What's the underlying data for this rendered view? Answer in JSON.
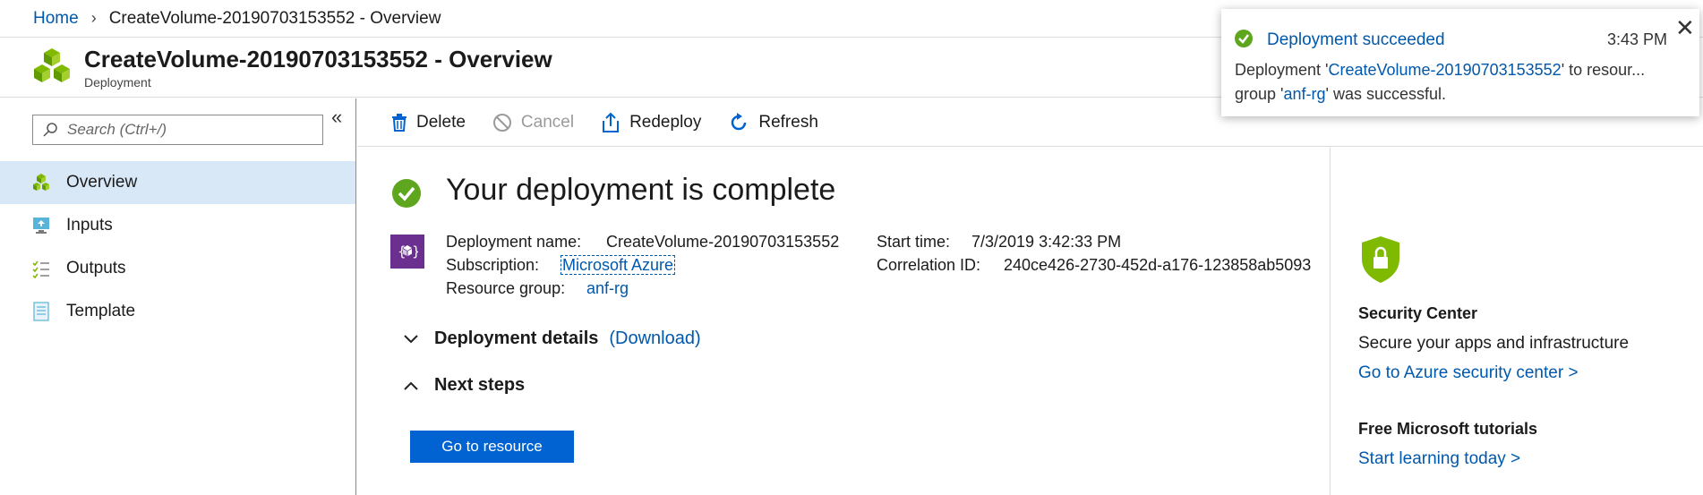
{
  "breadcrumb": {
    "home": "Home",
    "current": "CreateVolume-20190703153552 - Overview"
  },
  "header": {
    "title": "CreateVolume-20190703153552 - Overview",
    "subtitle": "Deployment"
  },
  "sidebar": {
    "search_placeholder": "Search (Ctrl+/)",
    "items": [
      {
        "label": "Overview",
        "icon": "cubes-icon",
        "active": true
      },
      {
        "label": "Inputs",
        "icon": "monitor-download-icon"
      },
      {
        "label": "Outputs",
        "icon": "checklist-icon"
      },
      {
        "label": "Template",
        "icon": "document-icon"
      }
    ]
  },
  "toolbar": {
    "delete": "Delete",
    "cancel": "Cancel",
    "redeploy": "Redeploy",
    "refresh": "Refresh"
  },
  "main": {
    "title": "Your deployment is complete",
    "deployment_name_label": "Deployment name:",
    "deployment_name": "CreateVolume-20190703153552",
    "subscription_label": "Subscription:",
    "subscription": "Microsoft Azure",
    "resource_group_label": "Resource group:",
    "resource_group": "anf-rg",
    "start_time_label": "Start time:",
    "start_time": "7/3/2019 3:42:33 PM",
    "correlation_label": "Correlation ID:",
    "correlation_id": "240ce426-2730-452d-a176-123858ab5093",
    "details_label": "Deployment details",
    "download_label": "(Download)",
    "next_steps_label": "Next steps",
    "go_button": "Go to resource"
  },
  "right_panel": {
    "security_title": "Security Center",
    "security_text": "Secure your apps and infrastructure",
    "security_link": "Go to Azure security center >",
    "tutorials_title": "Free Microsoft tutorials",
    "tutorials_link": "Start learning today >"
  },
  "toast": {
    "title": "Deployment succeeded",
    "time": "3:43 PM",
    "msg_prefix": "Deployment '",
    "msg_deployment": "CreateVolume-20190703153552",
    "msg_mid": "' to resour... group '",
    "msg_group": "anf-rg",
    "msg_suffix": "' was successful."
  },
  "colors": {
    "accent": "#0058ad",
    "success": "#5ea61e",
    "button": "#0063d1",
    "selected": "#d9e8f7"
  }
}
